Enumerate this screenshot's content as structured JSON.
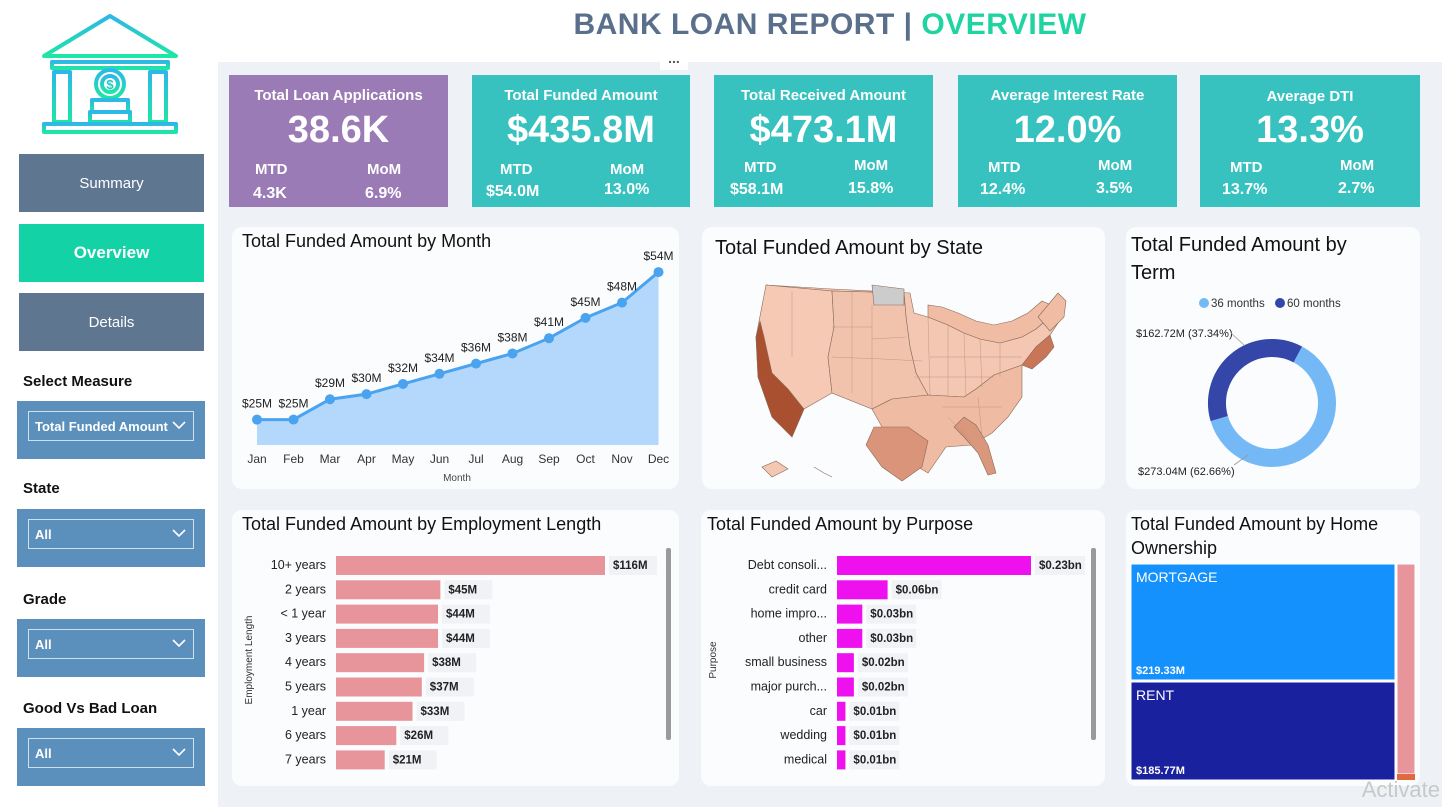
{
  "header": {
    "title_part1": "BANK LOAN REPORT | ",
    "title_part2": "OVERVIEW",
    "more_label": "..."
  },
  "nav": [
    {
      "label": "Summary"
    },
    {
      "label": "Overview"
    },
    {
      "label": "Details"
    }
  ],
  "filters": {
    "measure": {
      "label": "Select Measure",
      "value": "Total Funded Amount"
    },
    "state": {
      "label": "State",
      "value": "All"
    },
    "grade": {
      "label": "Grade",
      "value": "All"
    },
    "good_bad": {
      "label": "Good Vs Bad Loan",
      "value": "All"
    }
  },
  "kpis": [
    {
      "title": "Total Loan Applications",
      "value": "38.6K",
      "mtd_label": "MTD",
      "mtd": "4.3K",
      "mom_label": "MoM",
      "mom": "6.9%",
      "color": "#9b7bb6"
    },
    {
      "title": "Total Funded Amount",
      "value": "$435.8M",
      "mtd_label": "MTD",
      "mtd": "$54.0M",
      "mom_label": "MoM",
      "mom": "13.0%",
      "color": "#37c2c0"
    },
    {
      "title": "Total Received Amount",
      "value": "$473.1M",
      "mtd_label": "MTD",
      "mtd": "$58.1M",
      "mom_label": "MoM",
      "mom": "15.8%",
      "color": "#37c2c0"
    },
    {
      "title": "Average Interest Rate",
      "value": "12.0%",
      "mtd_label": "MTD",
      "mtd": "12.4%",
      "mom_label": "MoM",
      "mom": "3.5%",
      "color": "#37c2c0"
    },
    {
      "title": "Average DTI",
      "value": "13.3%",
      "mtd_label": "MTD",
      "mtd": "13.7%",
      "mom_label": "MoM",
      "mom": "2.7%",
      "color": "#37c2c0"
    }
  ],
  "month_chart": {
    "title": "Total Funded Amount by Month",
    "xlabel": "Month"
  },
  "state_map": {
    "title": "Total Funded Amount by State"
  },
  "term_chart": {
    "title": "Total Funded Amount by Term"
  },
  "emp_chart": {
    "title": "Total Funded Amount by Employment Length",
    "ylabel": "Employment Length"
  },
  "purpose_chart": {
    "title": "Total Funded Amount by Purpose",
    "ylabel": "Purpose"
  },
  "home_chart": {
    "title": "Total Funded Amount by Home Ownership"
  },
  "watermark": "Activate",
  "chart_data": [
    {
      "type": "area",
      "title": "Total Funded Amount by Month",
      "xlabel": "Month",
      "categories": [
        "Jan",
        "Feb",
        "Mar",
        "Apr",
        "May",
        "Jun",
        "Jul",
        "Aug",
        "Sep",
        "Oct",
        "Nov",
        "Dec"
      ],
      "values": [
        25,
        25,
        29,
        30,
        32,
        34,
        36,
        38,
        41,
        45,
        48,
        54
      ],
      "labels": [
        "$25M",
        "$25M",
        "$29M",
        "$30M",
        "$32M",
        "$34M",
        "$36M",
        "$38M",
        "$41M",
        "$45M",
        "$48M",
        "$54M"
      ],
      "color": "#4aa3ee",
      "fill": "#b3d8fb"
    },
    {
      "type": "pie",
      "title": "Total Funded Amount by Term",
      "series": [
        {
          "name": "36 months",
          "value": 273.04,
          "label": "$273.04M (62.66%)",
          "color": "#74b9f6"
        },
        {
          "name": "60 months",
          "value": 162.72,
          "label": "$162.72M (37.34%)",
          "color": "#3446a8"
        }
      ]
    },
    {
      "type": "bar",
      "title": "Total Funded Amount by Employment Length",
      "ylabel": "Employment Length",
      "categories": [
        "10+ years",
        "2 years",
        "< 1 year",
        "3 years",
        "4 years",
        "5 years",
        "1 year",
        "6 years",
        "7 years"
      ],
      "values": [
        116,
        45,
        44,
        44,
        38,
        37,
        33,
        26,
        21
      ],
      "labels": [
        "$116M",
        "$45M",
        "$44M",
        "$44M",
        "$38M",
        "$37M",
        "$33M",
        "$26M",
        "$21M"
      ],
      "color": "#e8949b"
    },
    {
      "type": "bar",
      "title": "Total Funded Amount by Purpose",
      "ylabel": "Purpose",
      "categories": [
        "Debt consoli...",
        "credit card",
        "home impro...",
        "other",
        "small business",
        "major purch...",
        "car",
        "wedding",
        "medical"
      ],
      "values": [
        0.23,
        0.06,
        0.03,
        0.03,
        0.02,
        0.02,
        0.01,
        0.01,
        0.01
      ],
      "labels": [
        "$0.23bn",
        "$0.06bn",
        "$0.03bn",
        "$0.03bn",
        "$0.02bn",
        "$0.02bn",
        "$0.01bn",
        "$0.01bn",
        "$0.01bn"
      ],
      "color": "#ee10ee"
    },
    {
      "type": "heatmap",
      "title": "Total Funded Amount by Home Ownership",
      "series": [
        {
          "name": "MORTGAGE",
          "label": "$219.33M",
          "color": "#1591fd"
        },
        {
          "name": "RENT",
          "label": "$185.77M",
          "color": "#1a219e"
        }
      ]
    }
  ]
}
